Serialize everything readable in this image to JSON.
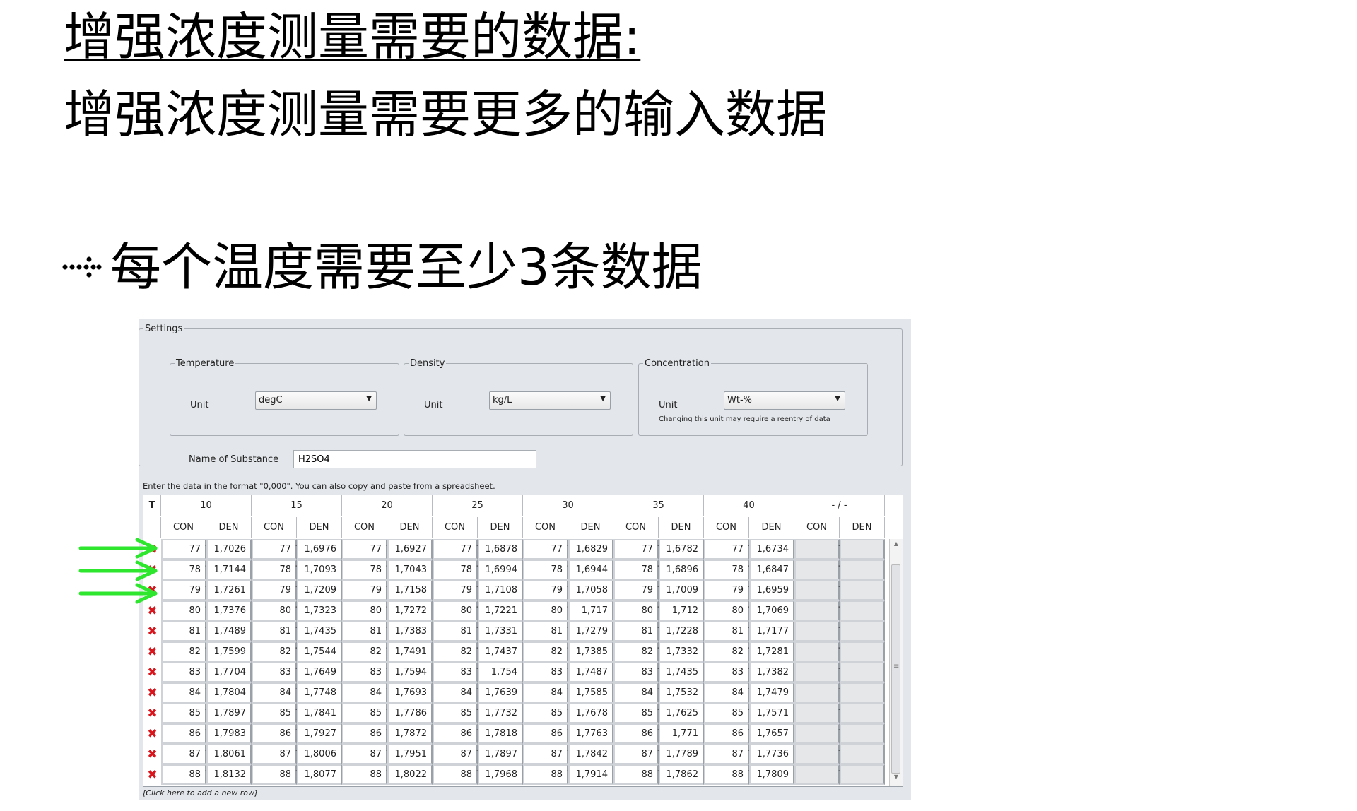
{
  "slide": {
    "title": "增强浓度测量需要的数据:",
    "subtitle": "增强浓度测量需要更多的输入数据",
    "bullet": "每个温度需要至少3条数据"
  },
  "settings": {
    "legend": "Settings",
    "temperature": {
      "legend": "Temperature",
      "unit_label": "Unit",
      "unit_value": "degC"
    },
    "density": {
      "legend": "Density",
      "unit_label": "Unit",
      "unit_value": "kg/L"
    },
    "concentration": {
      "legend": "Concentration",
      "unit_label": "Unit",
      "unit_value": "Wt-%",
      "note": "Changing this unit may require a reentry of data"
    },
    "substance_label": "Name of Substance",
    "substance_value": "H2SO4"
  },
  "grid": {
    "hint": "Enter the data in the format \"0,000\". You can also copy and paste from a spreadsheet.",
    "t_label": "T",
    "temperatures": [
      "10",
      "15",
      "20",
      "25",
      "30",
      "35",
      "40",
      "- / -"
    ],
    "sub_con": "CON",
    "sub_den": "DEN",
    "con_values": [
      "77",
      "78",
      "79",
      "80",
      "81",
      "82",
      "83",
      "84",
      "85",
      "86",
      "87",
      "88"
    ],
    "den_columns": [
      [
        "1,7026",
        "1,7144",
        "1,7261",
        "1,7376",
        "1,7489",
        "1,7599",
        "1,7704",
        "1,7804",
        "1,7897",
        "1,7983",
        "1,8061",
        "1,8132"
      ],
      [
        "1,6976",
        "1,7093",
        "1,7209",
        "1,7323",
        "1,7435",
        "1,7544",
        "1,7649",
        "1,7748",
        "1,7841",
        "1,7927",
        "1,8006",
        "1,8077"
      ],
      [
        "1,6927",
        "1,7043",
        "1,7158",
        "1,7272",
        "1,7383",
        "1,7491",
        "1,7594",
        "1,7693",
        "1,7786",
        "1,7872",
        "1,7951",
        "1,8022"
      ],
      [
        "1,6878",
        "1,6994",
        "1,7108",
        "1,7221",
        "1,7331",
        "1,7437",
        "1,754",
        "1,7639",
        "1,7732",
        "1,7818",
        "1,7897",
        "1,7968"
      ],
      [
        "1,6829",
        "1,6944",
        "1,7058",
        "1,717",
        "1,7279",
        "1,7385",
        "1,7487",
        "1,7585",
        "1,7678",
        "1,7763",
        "1,7842",
        "1,7914"
      ],
      [
        "1,6782",
        "1,6896",
        "1,7009",
        "1,712",
        "1,7228",
        "1,7332",
        "1,7435",
        "1,7532",
        "1,7625",
        "1,771",
        "1,7789",
        "1,7862"
      ],
      [
        "1,6734",
        "1,6847",
        "1,6959",
        "1,7069",
        "1,7177",
        "1,7281",
        "1,7382",
        "1,7479",
        "1,7571",
        "1,7657",
        "1,7736",
        "1,7809"
      ]
    ],
    "delete_icon": "delete-row-icon",
    "add_row": "[Click here to add a new row]"
  },
  "colors": {
    "delete": "#d8151c",
    "arrow": "#2ee62e"
  }
}
